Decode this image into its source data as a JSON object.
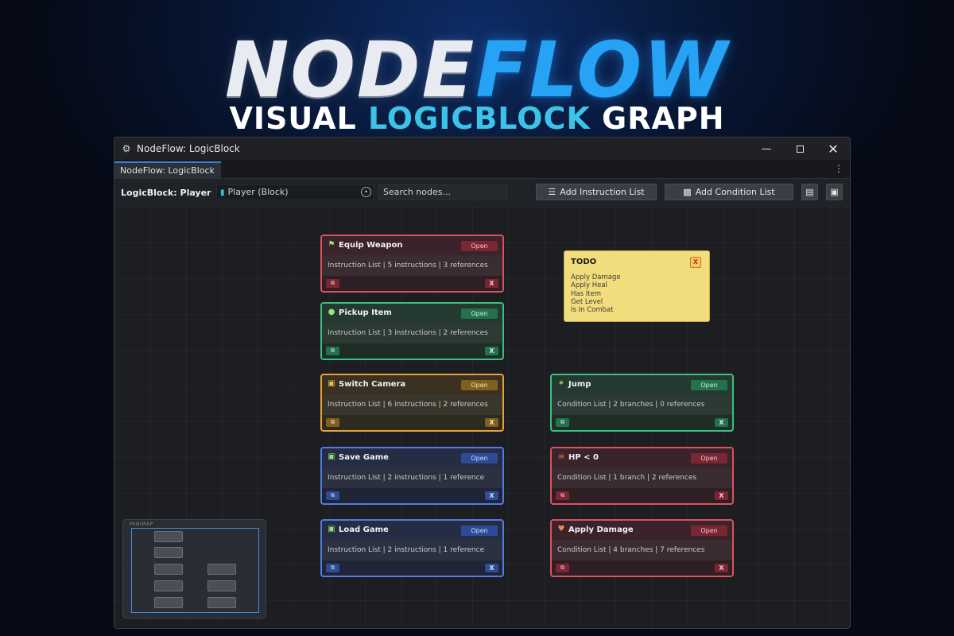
{
  "hero": {
    "title_part1": "NODE",
    "title_part2": "FLOW",
    "subtitle_part1": "VISUAL ",
    "subtitle_highlight": "LOGICBLOCK",
    "subtitle_part2": " GRAPH"
  },
  "window": {
    "title": "NodeFlow: LogicBlock",
    "tab_label": "NodeFlow: LogicBlock"
  },
  "toolbar": {
    "logicblock_label": "LogicBlock: Player",
    "block_field_value": "Player (Block)",
    "search_placeholder": "Search nodes...",
    "add_instruction_list": "Add Instruction List",
    "add_condition_list": "Add Condition List"
  },
  "nodes": [
    {
      "title": "Equip Weapon",
      "open": "Open",
      "info": "Instruction List | 5 instructions | 3 references",
      "delete": "X",
      "color": "#d9525e",
      "icon": "weapon-icon"
    },
    {
      "title": "Pickup Item",
      "open": "Open",
      "info": "Instruction List | 3 instructions | 2 references",
      "delete": "X",
      "color": "#3bbf82",
      "icon": "potion-icon"
    },
    {
      "title": "Switch Camera",
      "open": "Open",
      "info": "Instruction List | 6 instructions | 2 references",
      "delete": "X",
      "color": "#e5a33a",
      "icon": "camera-icon"
    },
    {
      "title": "Save Game",
      "open": "Open",
      "info": "Instruction List | 2 instructions | 1 reference",
      "delete": "X",
      "color": "#4f7de0",
      "icon": "save-icon"
    },
    {
      "title": "Load Game",
      "open": "Open",
      "info": "Instruction List | 2 instructions | 1 reference",
      "delete": "X",
      "color": "#4f7de0",
      "icon": "load-icon"
    },
    {
      "title": "Jump",
      "open": "Open",
      "info": "Condition List | 2 branches | 0 references",
      "delete": "X",
      "color": "#3bbf82",
      "icon": "jump-icon"
    },
    {
      "title": "HP < 0",
      "open": "Open",
      "info": "Condition List | 1 branch | 2 references",
      "delete": "X",
      "color": "#d9525e",
      "icon": "skull-icon"
    },
    {
      "title": "Apply Damage",
      "open": "Open",
      "info": "Condition List | 4 branches | 7 references",
      "delete": "X",
      "color": "#d9525e",
      "icon": "heart-icon"
    }
  ],
  "sticky_note": {
    "title": "TODO",
    "close": "X",
    "items": [
      "Apply Damage",
      "Apply Heal",
      "Has Item",
      "Get Level",
      "Is In Combat"
    ]
  },
  "minimap": {
    "label": "MINIMAP"
  }
}
